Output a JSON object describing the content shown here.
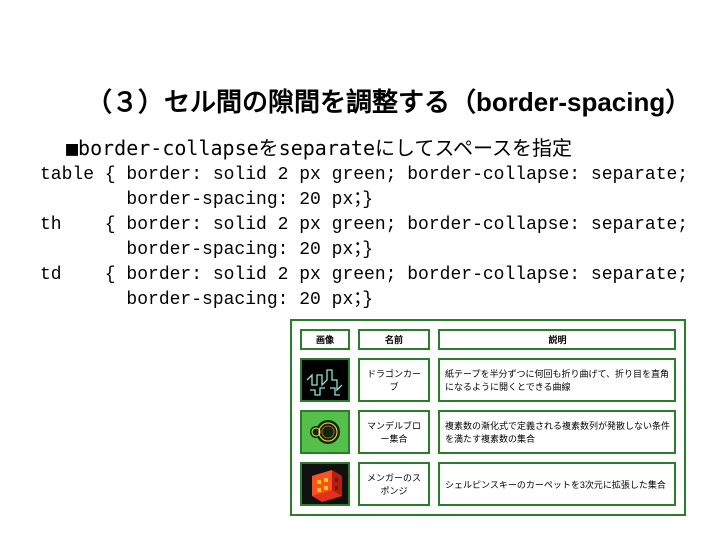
{
  "title": "（３）セル間の隙間を調整する（border-spacing）",
  "subtitle": "■border-collapseをseparateにしてスペースを指定",
  "code": {
    "l1a": "table { border: solid 2 px green; border-collapse: separate;",
    "l1b": "        border-spacing: 20 px；}",
    "l2a": "th    { border: solid 2 px green; border-collapse: separate;",
    "l2b": "        border-spacing: 20 px；}",
    "l3a": "td    { border: solid 2 px green; border-collapse: separate;",
    "l3b": "        border-spacing: 20 px；}"
  },
  "table": {
    "headers": [
      "画像",
      "名前",
      "説明"
    ],
    "rows": [
      {
        "name": "ドラゴンカーブ",
        "desc": "紙テープを半分ずつに何回も折り曲げて、折り目を直角になるように開くとできる曲線"
      },
      {
        "name": "マンデルブロー集合",
        "desc": "複素数の漸化式で定義される複素数列が発散しない条件を満たす複素数の集合"
      },
      {
        "name": "メンガーのスポンジ",
        "desc": "シェルピンスキーのカーペットを3次元に拡張した集合"
      }
    ]
  }
}
